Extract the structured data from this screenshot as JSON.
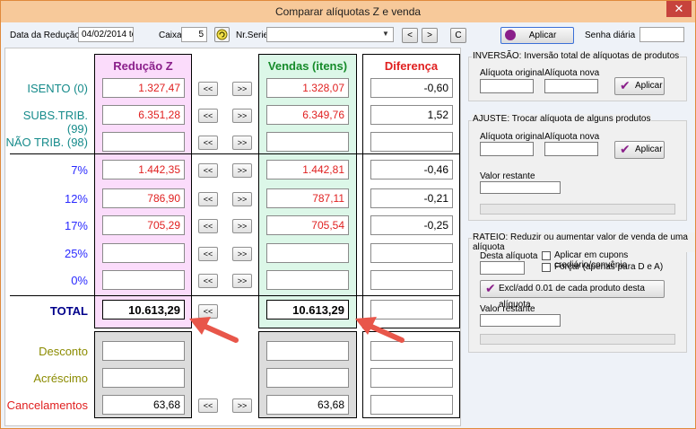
{
  "window": {
    "title": "Comparar alíquotas Z e venda",
    "close_glyph": "✕"
  },
  "toolbar": {
    "data_label": "Data da Redução Z",
    "data_value": "04/02/2014 ter",
    "caixa_label": "Caixa",
    "caixa_value": "5",
    "nrserie_label": "Nr.Serie",
    "nrserie_value": "",
    "prev_label": "<",
    "next_label": ">",
    "c_label": "C",
    "aplicar_label": "Aplicar",
    "senha_label": "Senha diária",
    "senha_value": ""
  },
  "columns": {
    "reducao": "Redução Z",
    "vendas": "Vendas (itens)",
    "diferenca": "Diferença"
  },
  "arrows": {
    "left": "<<",
    "right": ">>"
  },
  "rows": [
    {
      "label": "ISENTO (0)",
      "reducao": "1.327,47",
      "vendas": "1.328,07",
      "diferenca": "-0,60"
    },
    {
      "label": "SUBS.TRIB. (99)",
      "reducao": "6.351,28",
      "vendas": "6.349,76",
      "diferenca": "1,52"
    },
    {
      "label": "NÃO TRIB. (98)",
      "reducao": "",
      "vendas": "",
      "diferenca": ""
    },
    {
      "label": "7%",
      "reducao": "1.442,35",
      "vendas": "1.442,81",
      "diferenca": "-0,46"
    },
    {
      "label": "12%",
      "reducao": "786,90",
      "vendas": "787,11",
      "diferenca": "-0,21"
    },
    {
      "label": "17%",
      "reducao": "705,29",
      "vendas": "705,54",
      "diferenca": "-0,25"
    },
    {
      "label": "25%",
      "reducao": "",
      "vendas": "",
      "diferenca": ""
    },
    {
      "label": "0%",
      "reducao": "",
      "vendas": "",
      "diferenca": ""
    }
  ],
  "total": {
    "label": "TOTAL",
    "reducao": "10.613,29",
    "vendas": "10.613,29",
    "diferenca": ""
  },
  "extras": [
    {
      "label": "Desconto",
      "reducao": "",
      "vendas": "",
      "diferenca": ""
    },
    {
      "label": "Acréscimo",
      "reducao": "",
      "vendas": "",
      "diferenca": ""
    },
    {
      "label": "Cancelamentos",
      "reducao": "63,68",
      "vendas": "63,68",
      "diferenca": ""
    }
  ],
  "inversao": {
    "title": "INVERSÃO: Inversão total de alíquotas de produtos",
    "orig_label": "Alíquota original",
    "nova_label": "Alíquota nova",
    "apply_label": "Aplicar"
  },
  "ajuste": {
    "title": "AJUSTE: Trocar alíquota de alguns produtos",
    "orig_label": "Alíquota original",
    "nova_label": "Alíquota nova",
    "apply_label": "Aplicar",
    "restante_label": "Valor restante"
  },
  "rateio": {
    "title": "RATEIO: Reduzir ou aumentar valor de venda de uma alíquota",
    "desta_label": "Desta alíquota",
    "cb1_label": "Aplicar em cupons crediário/convênio",
    "cb2_label": "Forçar (apenas para D e A)",
    "excl_label": "Excl/add 0.01 de cada produto desta alíquota",
    "restante_label": "Valor restante"
  },
  "colors": {
    "annotation_arrow": "#e8564a",
    "reducao_bg": "#fbdcfb",
    "vendas_bg": "#dcf7e8",
    "accent_title": "#f7c99a"
  }
}
